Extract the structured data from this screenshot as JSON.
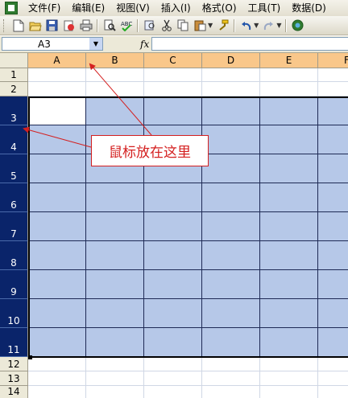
{
  "menu": {
    "items": [
      {
        "key": "file",
        "label": "文件(F)"
      },
      {
        "key": "edit",
        "label": "编辑(E)"
      },
      {
        "key": "view",
        "label": "视图(V)"
      },
      {
        "key": "insert",
        "label": "插入(I)"
      },
      {
        "key": "format",
        "label": "格式(O)"
      },
      {
        "key": "tools",
        "label": "工具(T)"
      },
      {
        "key": "data",
        "label": "数据(D)"
      }
    ]
  },
  "toolbar": {
    "icons": [
      "new-icon",
      "open-icon",
      "save-icon",
      "permission-icon",
      "print-icon",
      "print-preview-icon",
      "spelling-icon",
      "research-icon",
      "cut-icon",
      "copy-icon",
      "paste-icon",
      "format-painter-icon",
      "undo-icon",
      "redo-icon",
      "help-icon"
    ]
  },
  "formula_bar": {
    "name_box": "A3",
    "fx_label": "fx",
    "formula": ""
  },
  "sheet": {
    "columns": [
      "A",
      "B",
      "C",
      "D",
      "E",
      "F"
    ],
    "rows": [
      "1",
      "2",
      "3",
      "4",
      "5",
      "6",
      "7",
      "8",
      "9",
      "10",
      "11",
      "12",
      "13",
      "14"
    ],
    "selected_rows": [
      "3",
      "4",
      "5",
      "6",
      "7",
      "8",
      "9",
      "10",
      "11"
    ],
    "active_cell": "A3",
    "colors": {
      "selection_fill": "#b6c8e8",
      "row_header_selected": "#0a246a",
      "col_header_highlight": "#f9c78a",
      "annotation": "#d42020"
    }
  },
  "annotation": {
    "text": "鼠标放在这里"
  }
}
